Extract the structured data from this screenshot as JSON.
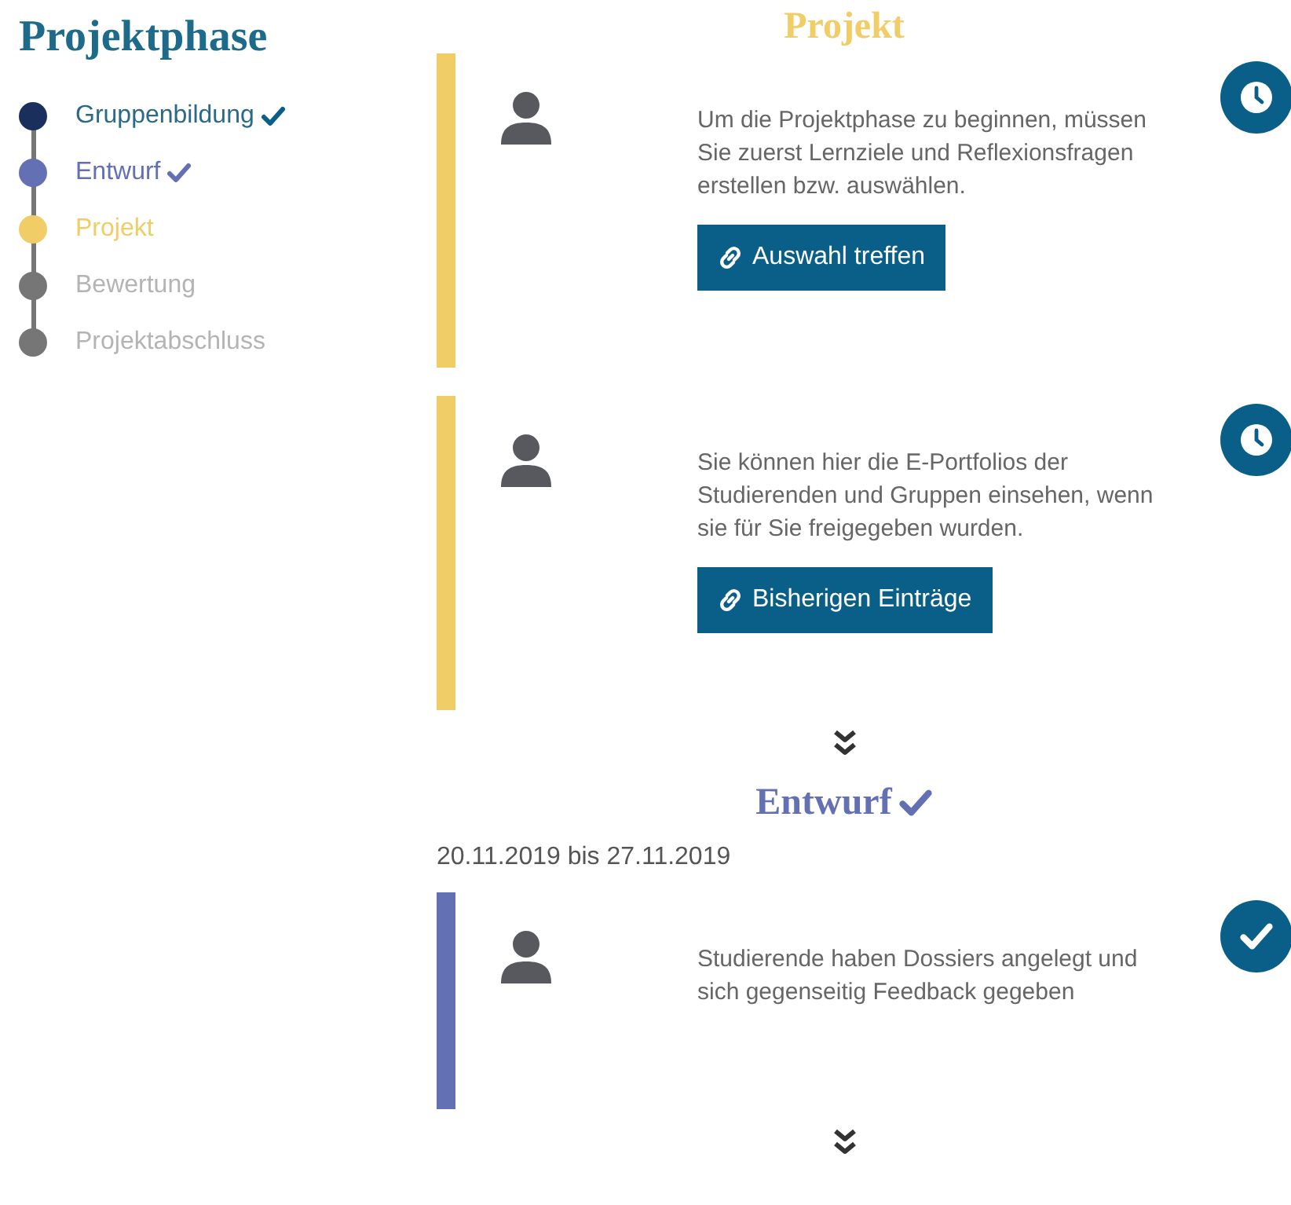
{
  "sidebar": {
    "title": "Projektphase",
    "steps": [
      {
        "label": "Gruppenbildung",
        "color": "#1b2f5c",
        "done": true,
        "pending": false
      },
      {
        "label": "Entwurf",
        "color": "#6470b4",
        "done": true,
        "pending": false
      },
      {
        "label": "Projekt",
        "color": "#f0cd66",
        "done": false,
        "pending": false
      },
      {
        "label": "Bewertung",
        "color": "#767676",
        "done": false,
        "pending": true
      },
      {
        "label": "Projektabschluss",
        "color": "#767676",
        "done": false,
        "pending": true
      }
    ]
  },
  "sections": [
    {
      "title": "Projekt",
      "color": "#f0cd66",
      "cards": [
        {
          "text": "Um die Projektphase zu beginnen, müssen Sie zuerst Lernziele und Reflexionsfragen erstellen bzw. auswählen.",
          "button": "Auswahl treffen",
          "kind": "clock"
        },
        {
          "text": "Sie können hier die E-Portfolios der Studierenden und Gruppen einsehen, wenn sie für Sie freigegeben wurden.",
          "button": "Bisherigen Einträge",
          "kind": "clock"
        }
      ]
    },
    {
      "title": "Entwurf",
      "color": "#6470b4",
      "done": true,
      "date": "20.11.2019 bis 27.11.2019",
      "cards": [
        {
          "text": "Studierende haben Dossiers angelegt und sich gegenseitig Feedback gegeben",
          "kind": "done"
        }
      ]
    }
  ]
}
